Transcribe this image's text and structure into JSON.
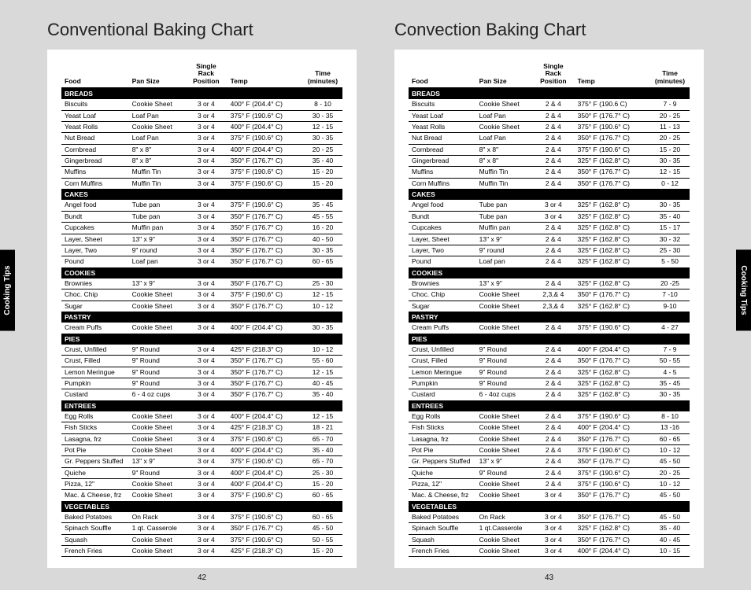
{
  "sideTab": "Cooking Tips",
  "pages": [
    {
      "title": "Conventional Baking Chart",
      "pageNumber": "42",
      "headers": {
        "food": "Food",
        "pan": "Pan Size",
        "pos": "Single Rack Position",
        "temp": "Temp",
        "time": "Time (minutes)"
      },
      "sections": [
        {
          "name": "BREADS",
          "rows": [
            {
              "f": "Biscuits",
              "p": "Cookie Sheet",
              "r": "3 or 4",
              "t": "400° F (204.4° C)",
              "m": "8 - 10"
            },
            {
              "f": "Yeast Loaf",
              "p": "Loaf Pan",
              "r": "3 or 4",
              "t": "375° F (190.6° C)",
              "m": "30 - 35"
            },
            {
              "f": "Yeast Rolls",
              "p": "Cookie Sheet",
              "r": "3 or 4",
              "t": "400° F (204.4° C)",
              "m": "12 - 15"
            },
            {
              "f": "Nut Bread",
              "p": "Loaf Pan",
              "r": "3 or 4",
              "t": "375° F (190.6° C)",
              "m": "30 - 35"
            },
            {
              "f": "Cornbread",
              "p": "8\" x 8\"",
              "r": "3 or 4",
              "t": "400° F (204.4° C)",
              "m": "20 - 25"
            },
            {
              "f": "Gingerbread",
              "p": "8\" x 8\"",
              "r": "3 or 4",
              "t": "350° F (176.7° C)",
              "m": "35 - 40"
            },
            {
              "f": "Muffins",
              "p": "Muffin Tin",
              "r": "3 or 4",
              "t": "375° F (190.6° C)",
              "m": "15 - 20"
            },
            {
              "f": "Corn Muffins",
              "p": "Muffin Tin",
              "r": "3 or 4",
              "t": "375° F (190.6° C)",
              "m": "15 - 20"
            }
          ]
        },
        {
          "name": "CAKES",
          "rows": [
            {
              "f": "Angel food",
              "p": "Tube pan",
              "r": "3 or 4",
              "t": "375° F (190.6° C)",
              "m": "35 - 45"
            },
            {
              "f": "Bundt",
              "p": "Tube pan",
              "r": "3 or 4",
              "t": "350° F (176.7° C)",
              "m": "45 - 55"
            },
            {
              "f": "Cupcakes",
              "p": "Muffin pan",
              "r": "3 or 4",
              "t": "350° F (176.7° C)",
              "m": "16 - 20"
            },
            {
              "f": "Layer, Sheet",
              "p": "13\" x 9\"",
              "r": "3 or 4",
              "t": "350° F (176.7° C)",
              "m": "40 - 50"
            },
            {
              "f": "Layer, Two",
              "p": "9\" round",
              "r": "3 or 4",
              "t": "350° F (176.7° C)",
              "m": "30 - 35"
            },
            {
              "f": "Pound",
              "p": "Loaf pan",
              "r": "3 or 4",
              "t": "350° F (176.7° C)",
              "m": "60 - 65"
            }
          ]
        },
        {
          "name": "COOKIES",
          "rows": [
            {
              "f": "Brownies",
              "p": "13\" x 9\"",
              "r": "3 or 4",
              "t": "350° F (176.7° C)",
              "m": "25 - 30"
            },
            {
              "f": "Choc. Chip",
              "p": "Cookie Sheet",
              "r": "3 or 4",
              "t": "375° F (190.6° C)",
              "m": "12 - 15"
            },
            {
              "f": "Sugar",
              "p": "Cookie Sheet",
              "r": "3 or 4",
              "t": "350° F (176.7° C)",
              "m": "10 - 12"
            }
          ]
        },
        {
          "name": "PASTRY",
          "rows": [
            {
              "f": "Cream Puffs",
              "p": "Cookie Sheet",
              "r": "3 or 4",
              "t": "400° F (204.4° C)",
              "m": "30 - 35"
            }
          ]
        },
        {
          "name": "PIES",
          "rows": [
            {
              "f": "Crust, Unfilled",
              "p": "9\" Round",
              "r": "3 or 4",
              "t": "425° F (218.3° C)",
              "m": "10 - 12"
            },
            {
              "f": "Crust, Filled",
              "p": "9\" Round",
              "r": "3 or 4",
              "t": "350° F (176.7° C)",
              "m": "55 - 60"
            },
            {
              "f": "Lemon Meringue",
              "p": "9\" Round",
              "r": "3 or 4",
              "t": "350° F (176.7° C)",
              "m": "12 - 15"
            },
            {
              "f": "Pumpkin",
              "p": "9\" Round",
              "r": "3 or 4",
              "t": "350° F (176.7° C)",
              "m": "40 - 45"
            },
            {
              "f": "Custard",
              "p": "6 - 4 oz cups",
              "r": "3 or 4",
              "t": "350° F (176.7° C)",
              "m": "35 - 40"
            }
          ]
        },
        {
          "name": "ENTREES",
          "rows": [
            {
              "f": "Egg Rolls",
              "p": "Cookie Sheet",
              "r": "3 or 4",
              "t": "400° F (204.4° C)",
              "m": "12 - 15"
            },
            {
              "f": "Fish Sticks",
              "p": "Cookie Sheet",
              "r": "3 or 4",
              "t": "425° F (218.3° C)",
              "m": "18 - 21"
            },
            {
              "f": "Lasagna, frz",
              "p": "Cookie Sheet",
              "r": "3 or 4",
              "t": "375° F (190.6° C)",
              "m": "65 - 70"
            },
            {
              "f": "Pot Pie",
              "p": "Cookie Sheet",
              "r": "3 or 4",
              "t": "400° F (204.4° C)",
              "m": "35 - 40"
            },
            {
              "f": "Gr. Peppers Stuffed",
              "p": "13\" x 9\"",
              "r": "3 or 4",
              "t": "375° F (190.6° C)",
              "m": "65 - 70"
            },
            {
              "f": "Quiche",
              "p": "9\" Round",
              "r": "3 or 4",
              "t": "400° F (204.4° C)",
              "m": "25 - 30"
            },
            {
              "f": "Pizza, 12\"",
              "p": "Cookie Sheet",
              "r": "3 or 4",
              "t": "400° F (204.4° C)",
              "m": "15 - 20"
            },
            {
              "f": "Mac. & Cheese, frz",
              "p": "Cookie Sheet",
              "r": "3 or 4",
              "t": "375° F (190.6° C)",
              "m": "60 - 65"
            }
          ]
        },
        {
          "name": "VEGETABLES",
          "rows": [
            {
              "f": "Baked Potatoes",
              "p": "On Rack",
              "r": "3 or 4",
              "t": "375° F (190.6° C)",
              "m": "60 - 65"
            },
            {
              "f": "Spinach Souffle",
              "p": "1 qt. Casserole",
              "r": "3 or 4",
              "t": "350° F (176.7° C)",
              "m": "45 - 50"
            },
            {
              "f": "Squash",
              "p": "Cookie Sheet",
              "r": "3 or 4",
              "t": "375° F (190.6° C)",
              "m": "50 - 55"
            },
            {
              "f": "French Fries",
              "p": "Cookie Sheet",
              "r": "3 or 4",
              "t": "425° F (218.3° C)",
              "m": "15 - 20"
            }
          ]
        }
      ]
    },
    {
      "title": "Convection Baking Chart",
      "pageNumber": "43",
      "headers": {
        "food": "Food",
        "pan": "Pan Size",
        "pos": "Single Rack Position",
        "temp": "Temp",
        "time": "Time (minutes)"
      },
      "sections": [
        {
          "name": "BREADS",
          "rows": [
            {
              "f": "Biscuits",
              "p": "Cookie Sheet",
              "r": "2 & 4",
              "t": "375° F (190.6 C)",
              "m": "7 - 9"
            },
            {
              "f": "Yeast Loaf",
              "p": "Loaf Pan",
              "r": "2 & 4",
              "t": "350° F (176.7° C)",
              "m": "20 - 25"
            },
            {
              "f": "Yeast Rolls",
              "p": "Cookie Sheet",
              "r": "2 & 4",
              "t": "375° F (190.6° C)",
              "m": "11 - 13"
            },
            {
              "f": "Nut Bread",
              "p": "Loaf Pan",
              "r": "2 & 4",
              "t": "350° F (176.7° C)",
              "m": "20 - 25"
            },
            {
              "f": "Cornbread",
              "p": "8\" x 8\"",
              "r": "2 & 4",
              "t": "375° F (190.6° C)",
              "m": "15 - 20"
            },
            {
              "f": "Gingerbread",
              "p": "8\" x 8\"",
              "r": "2 & 4",
              "t": "325° F (162.8° C)",
              "m": "30 - 35"
            },
            {
              "f": "Muffins",
              "p": "Muffin Tin",
              "r": "2 & 4",
              "t": "350° F (176.7° C)",
              "m": "12 - 15"
            },
            {
              "f": "Corn Muffins",
              "p": "Muffin Tin",
              "r": "2 & 4",
              "t": "350° F (176.7° C)",
              "m": "0 - 12"
            }
          ]
        },
        {
          "name": "CAKES",
          "rows": [
            {
              "f": "Angel food",
              "p": "Tube pan",
              "r": "3 or 4",
              "t": "325° F (162.8° C)",
              "m": "30 - 35"
            },
            {
              "f": "Bundt",
              "p": "Tube pan",
              "r": "3 or 4",
              "t": "325° F (162.8° C)",
              "m": "35 - 40"
            },
            {
              "f": "Cupcakes",
              "p": "Muffin pan",
              "r": "2 & 4",
              "t": "325° F (162.8° C)",
              "m": "15 - 17"
            },
            {
              "f": "Layer, Sheet",
              "p": "13\" x 9\"",
              "r": "2 & 4",
              "t": "325° F (162.8° C)",
              "m": "30 - 32"
            },
            {
              "f": "Layer, Two",
              "p": "9\" round",
              "r": "2 & 4",
              "t": "325° F (162.8° C)",
              "m": "25 - 30"
            },
            {
              "f": "Pound",
              "p": "Loaf pan",
              "r": "2 & 4",
              "t": "325° F (162.8° C)",
              "m": "5 - 50"
            }
          ]
        },
        {
          "name": "COOKIES",
          "rows": [
            {
              "f": "Brownies",
              "p": "13\" x 9\"",
              "r": "2 & 4",
              "t": "325° F (162.8° C)",
              "m": "20 -25"
            },
            {
              "f": "Choc. Chip",
              "p": "Cookie Sheet",
              "r": "2,3,& 4",
              "t": "350° F (176.7° C)",
              "m": "7 -10"
            },
            {
              "f": "Sugar",
              "p": "Cookie Sheet",
              "r": "2,3,& 4",
              "t": "325° F (162.8° C)",
              "m": "9-10"
            }
          ]
        },
        {
          "name": "PASTRY",
          "rows": [
            {
              "f": "Cream Puffs",
              "p": "Cookie Sheet",
              "r": "2 & 4",
              "t": "375° F (190.6° C)",
              "m": "4 - 27"
            }
          ]
        },
        {
          "name": "PIES",
          "rows": [
            {
              "f": "Crust, Unfilled",
              "p": "9\" Round",
              "r": "2 & 4",
              "t": "400° F (204.4° C)",
              "m": "7 - 9"
            },
            {
              "f": "Crust, Filled",
              "p": "9\" Round",
              "r": "2 & 4",
              "t": "350° F (176.7° C)",
              "m": "50 - 55"
            },
            {
              "f": "Lemon Meringue",
              "p": "9\" Round",
              "r": "2 & 4",
              "t": "325° F (162.8° C)",
              "m": "4 - 5"
            },
            {
              "f": "Pumpkin",
              "p": "9\" Round",
              "r": "2 & 4",
              "t": "325° F (162.8° C)",
              "m": "35 - 45"
            },
            {
              "f": "Custard",
              "p": "6 - 4oz cups",
              "r": "2 & 4",
              "t": "325° F (162.8° C)",
              "m": "30 - 35"
            }
          ]
        },
        {
          "name": "ENTREES",
          "rows": [
            {
              "f": "Egg Rolls",
              "p": "Cookie Sheet",
              "r": "2 & 4",
              "t": "375° F (190.6° C)",
              "m": "8 - 10"
            },
            {
              "f": "Fish Sticks",
              "p": "Cookie Sheet",
              "r": "2 & 4",
              "t": "400° F (204.4° C)",
              "m": "13 -16"
            },
            {
              "f": "Lasagna, frz",
              "p": "Cookie Sheet",
              "r": "2 & 4",
              "t": "350° F (176.7° C)",
              "m": "60 - 65"
            },
            {
              "f": "Pot Pie",
              "p": "Cookie Sheet",
              "r": "2 & 4",
              "t": "375° F (190.6° C)",
              "m": "10 - 12"
            },
            {
              "f": "Gr. Peppers Stuffed",
              "p": "13\" x 9\"",
              "r": "2 & 4",
              "t": "350° F (176.7° C)",
              "m": "45 - 50"
            },
            {
              "f": "Quiche",
              "p": "9\" Round",
              "r": "2 & 4",
              "t": "375° F (190.6° C)",
              "m": "20 - 25"
            },
            {
              "f": "Pizza, 12\"",
              "p": "Cookie Sheet",
              "r": "2 & 4",
              "t": "375° F (190.6° C)",
              "m": "10 - 12"
            },
            {
              "f": "Mac. & Cheese, frz",
              "p": "Cookie Sheet",
              "r": "3 or 4",
              "t": "350° F (176.7° C)",
              "m": "45 - 50"
            }
          ]
        },
        {
          "name": "VEGETABLES",
          "rows": [
            {
              "f": "Baked Potatoes",
              "p": "On Rack",
              "r": "3 or 4",
              "t": "350° F (176.7° C)",
              "m": "45 - 50"
            },
            {
              "f": "Spinach Souffle",
              "p": "1 qt.Casserole",
              "r": "3 or 4",
              "t": "325° F (162.8° C)",
              "m": "35 - 40"
            },
            {
              "f": "Squash",
              "p": "Cookie Sheet",
              "r": "3 or 4",
              "t": "350° F (176.7° C)",
              "m": "40 - 45"
            },
            {
              "f": "French Fries",
              "p": "Cookie Sheet",
              "r": "3 or 4",
              "t": "400° F (204.4° C)",
              "m": "10 - 15"
            }
          ]
        }
      ]
    }
  ]
}
